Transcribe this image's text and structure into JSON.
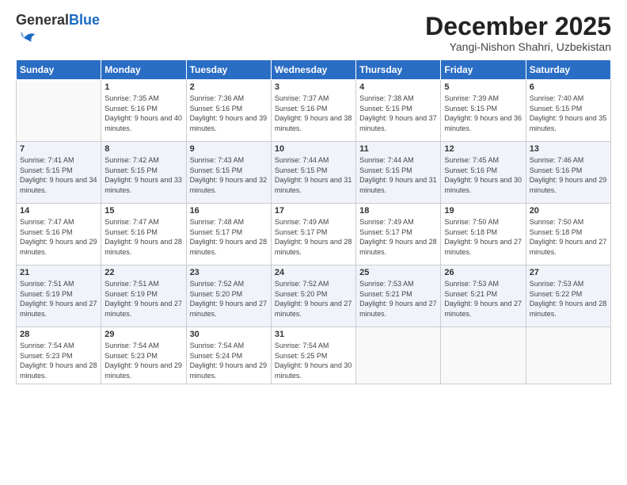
{
  "header": {
    "logo_general": "General",
    "logo_blue": "Blue",
    "month_title": "December 2025",
    "location": "Yangi-Nishon Shahri, Uzbekistan"
  },
  "weekdays": [
    "Sunday",
    "Monday",
    "Tuesday",
    "Wednesday",
    "Thursday",
    "Friday",
    "Saturday"
  ],
  "weeks": [
    [
      {
        "day": "",
        "sunrise": "",
        "sunset": "",
        "daylight": ""
      },
      {
        "day": "1",
        "sunrise": "Sunrise: 7:35 AM",
        "sunset": "Sunset: 5:16 PM",
        "daylight": "Daylight: 9 hours and 40 minutes."
      },
      {
        "day": "2",
        "sunrise": "Sunrise: 7:36 AM",
        "sunset": "Sunset: 5:16 PM",
        "daylight": "Daylight: 9 hours and 39 minutes."
      },
      {
        "day": "3",
        "sunrise": "Sunrise: 7:37 AM",
        "sunset": "Sunset: 5:16 PM",
        "daylight": "Daylight: 9 hours and 38 minutes."
      },
      {
        "day": "4",
        "sunrise": "Sunrise: 7:38 AM",
        "sunset": "Sunset: 5:15 PM",
        "daylight": "Daylight: 9 hours and 37 minutes."
      },
      {
        "day": "5",
        "sunrise": "Sunrise: 7:39 AM",
        "sunset": "Sunset: 5:15 PM",
        "daylight": "Daylight: 9 hours and 36 minutes."
      },
      {
        "day": "6",
        "sunrise": "Sunrise: 7:40 AM",
        "sunset": "Sunset: 5:15 PM",
        "daylight": "Daylight: 9 hours and 35 minutes."
      }
    ],
    [
      {
        "day": "7",
        "sunrise": "Sunrise: 7:41 AM",
        "sunset": "Sunset: 5:15 PM",
        "daylight": "Daylight: 9 hours and 34 minutes."
      },
      {
        "day": "8",
        "sunrise": "Sunrise: 7:42 AM",
        "sunset": "Sunset: 5:15 PM",
        "daylight": "Daylight: 9 hours and 33 minutes."
      },
      {
        "day": "9",
        "sunrise": "Sunrise: 7:43 AM",
        "sunset": "Sunset: 5:15 PM",
        "daylight": "Daylight: 9 hours and 32 minutes."
      },
      {
        "day": "10",
        "sunrise": "Sunrise: 7:44 AM",
        "sunset": "Sunset: 5:15 PM",
        "daylight": "Daylight: 9 hours and 31 minutes."
      },
      {
        "day": "11",
        "sunrise": "Sunrise: 7:44 AM",
        "sunset": "Sunset: 5:15 PM",
        "daylight": "Daylight: 9 hours and 31 minutes."
      },
      {
        "day": "12",
        "sunrise": "Sunrise: 7:45 AM",
        "sunset": "Sunset: 5:16 PM",
        "daylight": "Daylight: 9 hours and 30 minutes."
      },
      {
        "day": "13",
        "sunrise": "Sunrise: 7:46 AM",
        "sunset": "Sunset: 5:16 PM",
        "daylight": "Daylight: 9 hours and 29 minutes."
      }
    ],
    [
      {
        "day": "14",
        "sunrise": "Sunrise: 7:47 AM",
        "sunset": "Sunset: 5:16 PM",
        "daylight": "Daylight: 9 hours and 29 minutes."
      },
      {
        "day": "15",
        "sunrise": "Sunrise: 7:47 AM",
        "sunset": "Sunset: 5:16 PM",
        "daylight": "Daylight: 9 hours and 28 minutes."
      },
      {
        "day": "16",
        "sunrise": "Sunrise: 7:48 AM",
        "sunset": "Sunset: 5:17 PM",
        "daylight": "Daylight: 9 hours and 28 minutes."
      },
      {
        "day": "17",
        "sunrise": "Sunrise: 7:49 AM",
        "sunset": "Sunset: 5:17 PM",
        "daylight": "Daylight: 9 hours and 28 minutes."
      },
      {
        "day": "18",
        "sunrise": "Sunrise: 7:49 AM",
        "sunset": "Sunset: 5:17 PM",
        "daylight": "Daylight: 9 hours and 28 minutes."
      },
      {
        "day": "19",
        "sunrise": "Sunrise: 7:50 AM",
        "sunset": "Sunset: 5:18 PM",
        "daylight": "Daylight: 9 hours and 27 minutes."
      },
      {
        "day": "20",
        "sunrise": "Sunrise: 7:50 AM",
        "sunset": "Sunset: 5:18 PM",
        "daylight": "Daylight: 9 hours and 27 minutes."
      }
    ],
    [
      {
        "day": "21",
        "sunrise": "Sunrise: 7:51 AM",
        "sunset": "Sunset: 5:19 PM",
        "daylight": "Daylight: 9 hours and 27 minutes."
      },
      {
        "day": "22",
        "sunrise": "Sunrise: 7:51 AM",
        "sunset": "Sunset: 5:19 PM",
        "daylight": "Daylight: 9 hours and 27 minutes."
      },
      {
        "day": "23",
        "sunrise": "Sunrise: 7:52 AM",
        "sunset": "Sunset: 5:20 PM",
        "daylight": "Daylight: 9 hours and 27 minutes."
      },
      {
        "day": "24",
        "sunrise": "Sunrise: 7:52 AM",
        "sunset": "Sunset: 5:20 PM",
        "daylight": "Daylight: 9 hours and 27 minutes."
      },
      {
        "day": "25",
        "sunrise": "Sunrise: 7:53 AM",
        "sunset": "Sunset: 5:21 PM",
        "daylight": "Daylight: 9 hours and 27 minutes."
      },
      {
        "day": "26",
        "sunrise": "Sunrise: 7:53 AM",
        "sunset": "Sunset: 5:21 PM",
        "daylight": "Daylight: 9 hours and 27 minutes."
      },
      {
        "day": "27",
        "sunrise": "Sunrise: 7:53 AM",
        "sunset": "Sunset: 5:22 PM",
        "daylight": "Daylight: 9 hours and 28 minutes."
      }
    ],
    [
      {
        "day": "28",
        "sunrise": "Sunrise: 7:54 AM",
        "sunset": "Sunset: 5:23 PM",
        "daylight": "Daylight: 9 hours and 28 minutes."
      },
      {
        "day": "29",
        "sunrise": "Sunrise: 7:54 AM",
        "sunset": "Sunset: 5:23 PM",
        "daylight": "Daylight: 9 hours and 29 minutes."
      },
      {
        "day": "30",
        "sunrise": "Sunrise: 7:54 AM",
        "sunset": "Sunset: 5:24 PM",
        "daylight": "Daylight: 9 hours and 29 minutes."
      },
      {
        "day": "31",
        "sunrise": "Sunrise: 7:54 AM",
        "sunset": "Sunset: 5:25 PM",
        "daylight": "Daylight: 9 hours and 30 minutes."
      },
      {
        "day": "",
        "sunrise": "",
        "sunset": "",
        "daylight": ""
      },
      {
        "day": "",
        "sunrise": "",
        "sunset": "",
        "daylight": ""
      },
      {
        "day": "",
        "sunrise": "",
        "sunset": "",
        "daylight": ""
      }
    ]
  ]
}
